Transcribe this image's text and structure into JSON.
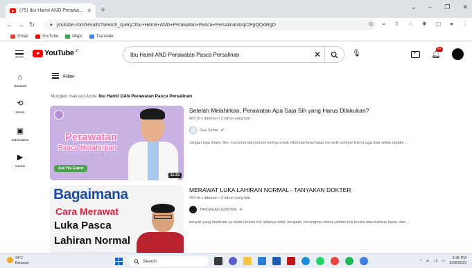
{
  "browser": {
    "tab_title": "(75) Ibu Hamil AND Perawatan Pas...",
    "url": "youtube.com/results?search_query=Ibu+Hamil+AND+Perawatan+Pasca+Persalinan&sp=EgQQARgD",
    "bookmarks": [
      {
        "label": "Gmail",
        "color": "#ea4335"
      },
      {
        "label": "YouTube",
        "color": "#ff0000"
      },
      {
        "label": "Maps",
        "color": "#34a853"
      },
      {
        "label": "Translate",
        "color": "#4285f4"
      }
    ]
  },
  "youtube": {
    "logo_text": "YouTube",
    "logo_cc": "ID",
    "search_value": "Ibu Hamil AND Perawatan Pasca Persalinan",
    "notification_count": "9+",
    "filter_label": "Filter",
    "did_you_mean_prefix": "Mungkin maksud Anda: ",
    "did_you_mean_part1": "Ibu Hamil ",
    "did_you_mean_part2": "DAN",
    "did_you_mean_part3": " Perawatan Pasca Persalinan"
  },
  "sidebar": [
    {
      "label": "Beranda",
      "icon": "home-icon"
    },
    {
      "label": "Shorts",
      "icon": "shorts-icon"
    },
    {
      "label": "Subscription",
      "icon": "subscriptions-icon"
    },
    {
      "label": "Koleksi",
      "icon": "library-icon"
    }
  ],
  "videos": [
    {
      "title": "Setelah Melahirkan, Perawatan Apa Saja Sih yang Harus Dilakukan?",
      "meta": "883 rb x ditonton • 2 tahun yang lalu",
      "channel": "Gue Sehat",
      "channel_color": "#e7f0fb",
      "description": "Jangan lupa share, like, comment dan pencet belnya untuk informasi kesehatan menarik lainnya! Kamu juga bisa selalu update ...",
      "duration": "11.23",
      "thumb_line1": "Perawatan",
      "thumb_line2": "Pasca Melahirkan",
      "thumb_badge": "Ask The Expert"
    },
    {
      "title": "MERAWAT LUKA LAHIRAN NORMAL - TANYAKAN DOKTER",
      "meta": "424 rb x ditonton • 3 tahun yang lalu",
      "channel": "TANYAKAN DOKTER",
      "channel_color": "#1b1b1b",
      "description": "banyak yang kepikiran ya habis lahiran kok lukanya sakit, bengkak, benangnya bekas jahitan kok teraba atau bahkan lepas, dan ...",
      "thumb_line1": "Bagaimana",
      "thumb_line2": "Cara Merawat",
      "thumb_line3": "Luka Pasca",
      "thumb_line4": "Lahiran Normal"
    }
  ],
  "taskbar": {
    "weather_temp": "34°C",
    "weather_desc": "Berawan",
    "search_label": "Search",
    "time": "3:45 PM",
    "date": "6/28/2023"
  }
}
